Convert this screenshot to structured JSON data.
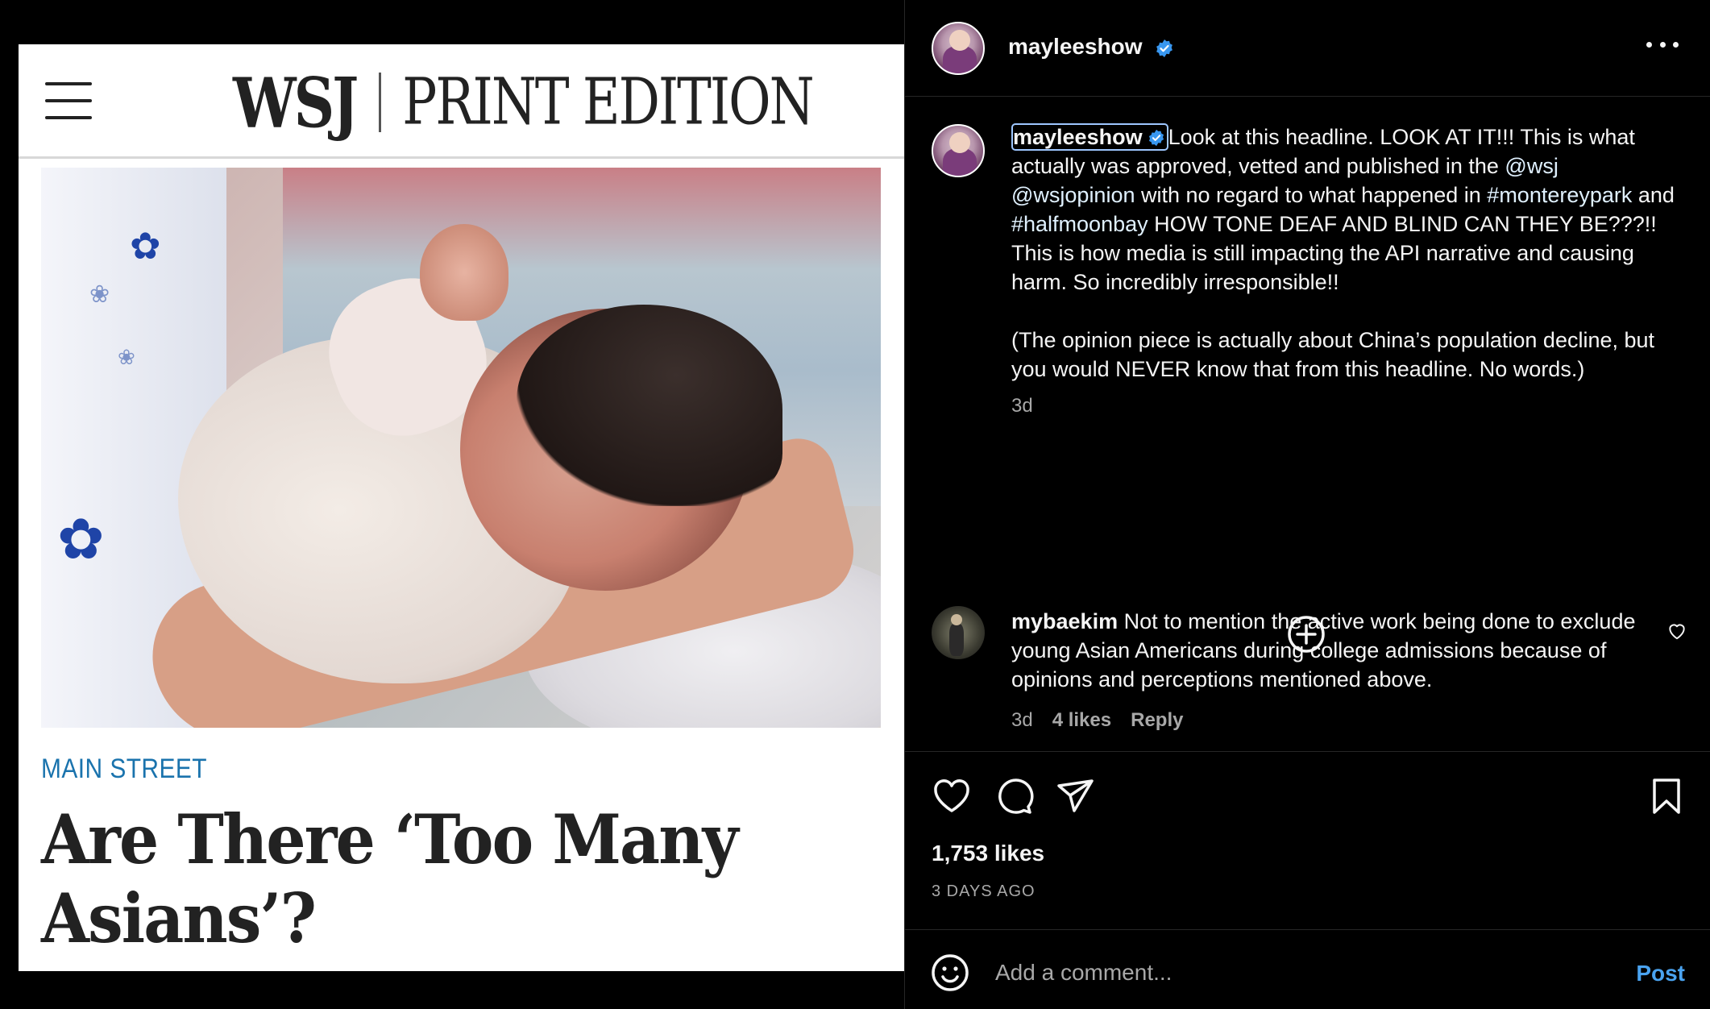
{
  "media": {
    "publication": "WSJ",
    "edition": "PRINT EDITION",
    "kicker": "MAIN STREET",
    "headline": "Are There ‘Too Many Asians’?"
  },
  "post": {
    "author": "mayleeshow",
    "verified": true,
    "caption_username": "mayleeshow",
    "caption": {
      "part1": "Look at this headline. LOOK AT IT!!! This is what actually was approved, vetted and published in the ",
      "mention1": "@wsj",
      "mention2": "@wsjopinion",
      "part2": " with no regard to what happened in ",
      "hashtag1": "#montereypark",
      "part3": " and ",
      "hashtag2": "#halfmoonbay",
      "part4": " HOW TONE DEAF AND BLIND CAN THEY BE???!! This is how media is still impacting the API narrative and causing harm. So incredibly irresponsible!!",
      "paragraph2": "(The opinion piece is actually about China’s population decline, but you would NEVER know that from this headline. No words.)"
    },
    "caption_age": "3d",
    "likes": "1,753 likes",
    "date": "3 DAYS AGO"
  },
  "comments": [
    {
      "username": "mybaekim",
      "text": "Not to mention the active work being done to exclude young Asian Americans during college admissions because of opinions and perceptions mentioned above.",
      "age": "3d",
      "likes": "4 likes",
      "reply": "Reply"
    }
  ],
  "composer": {
    "placeholder": "Add a comment...",
    "post_label": "Post"
  },
  "icons": {
    "more": "more-options-icon",
    "verified": "verified-badge-icon",
    "load_more": "plus-circle-icon",
    "like": "heart-icon",
    "comment": "comment-bubble-icon",
    "share": "paper-plane-icon",
    "save": "bookmark-icon",
    "emoji": "emoji-icon"
  },
  "colors": {
    "background": "#000000",
    "text": "#f5f5f5",
    "muted": "#a8a8a8",
    "verified": "#3897f0",
    "post_button": "#4aa3f0",
    "wsj_kicker": "#1a73ad"
  }
}
